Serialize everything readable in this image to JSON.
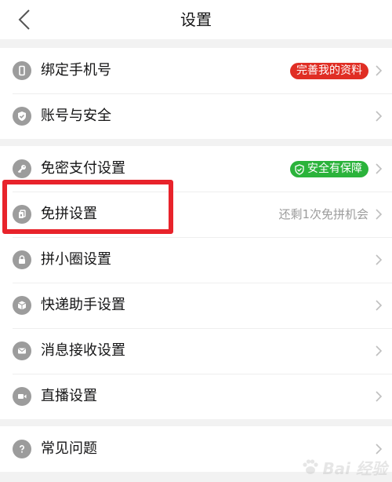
{
  "header": {
    "title": "设置"
  },
  "sections": [
    {
      "items": [
        {
          "label": "绑定手机号",
          "icon": "phone-icon",
          "badge": {
            "text": "完善我的资料",
            "color": "#e02e24"
          }
        },
        {
          "label": "账号与安全",
          "icon": "shield-check-icon"
        }
      ]
    },
    {
      "items": [
        {
          "label": "免密支付设置",
          "icon": "key-icon",
          "badge": {
            "text": "安全有保障",
            "color": "#2bb33b",
            "icon": "shield-check-icon"
          }
        },
        {
          "label": "免拼设置",
          "icon": "ticket-icon",
          "value": "还剩1次免拼机会"
        },
        {
          "label": "拼小圈设置",
          "icon": "lock-icon"
        },
        {
          "label": "快递助手设置",
          "icon": "package-icon"
        },
        {
          "label": "消息接收设置",
          "icon": "mail-icon"
        },
        {
          "label": "直播设置",
          "icon": "video-camera-icon"
        }
      ]
    },
    {
      "items": [
        {
          "label": "常见问题",
          "icon": "question-icon"
        }
      ]
    }
  ],
  "annotation": {
    "color": "#e8232b"
  },
  "watermark": {
    "text": "Bai 经验"
  }
}
